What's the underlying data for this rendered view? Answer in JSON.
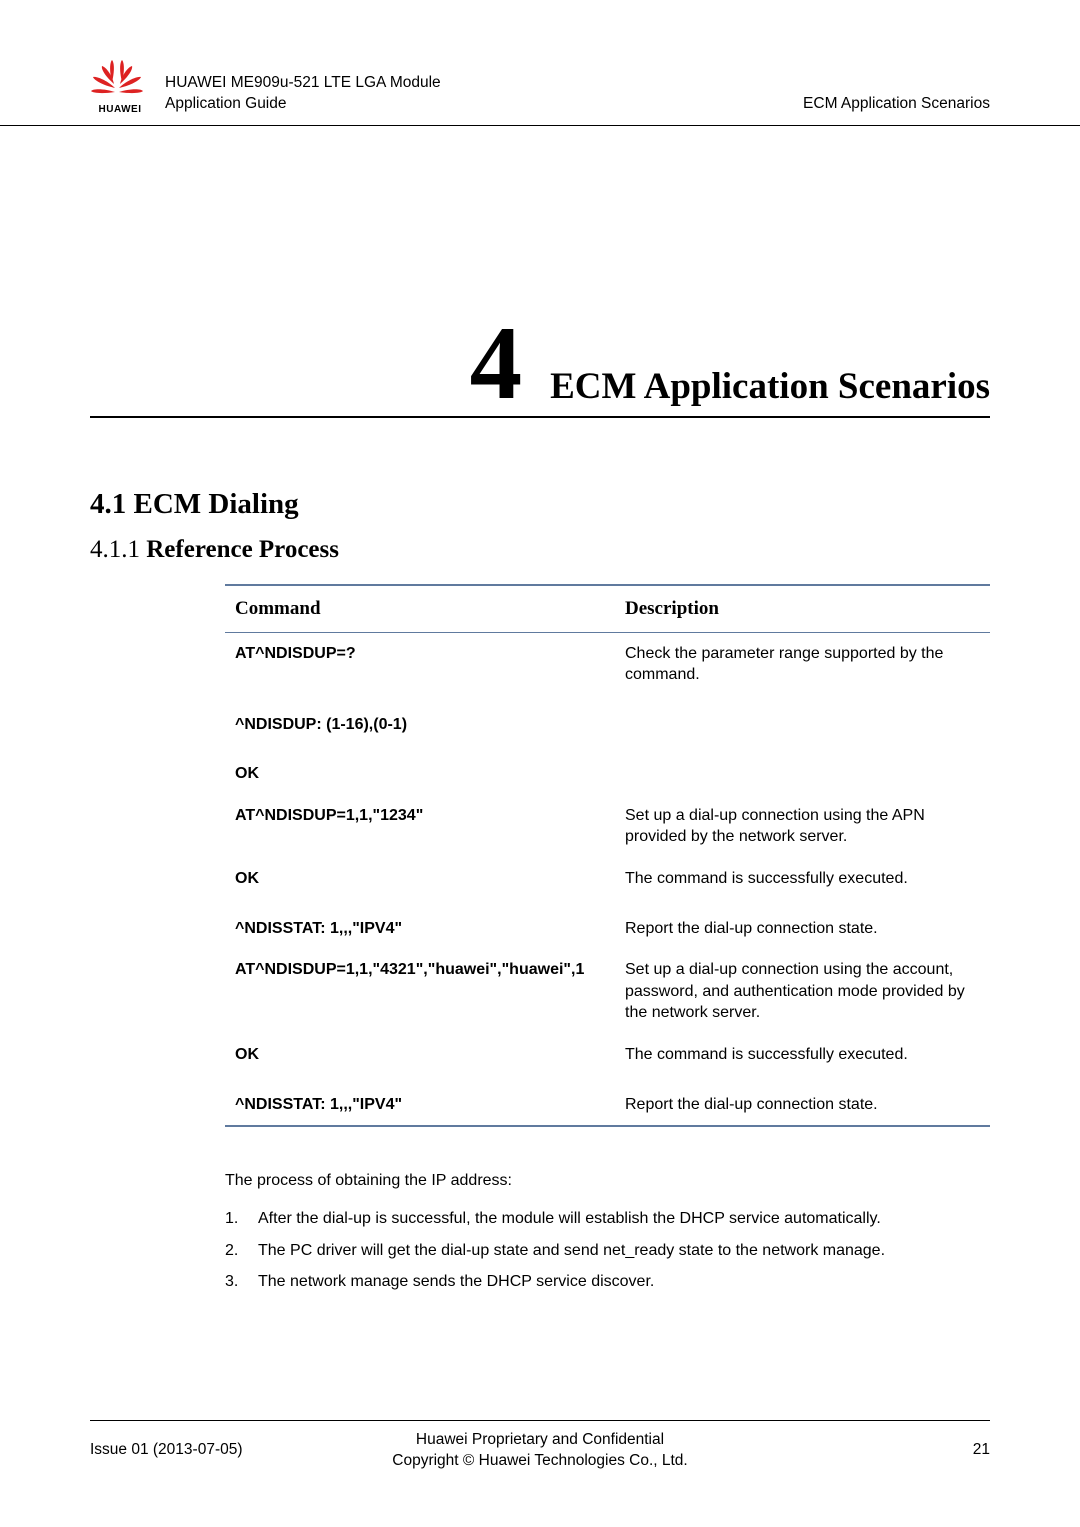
{
  "header": {
    "logo_brand": "HUAWEI",
    "title_line1": "HUAWEI ME909u-521 LTE LGA Module",
    "title_line2": "Application Guide",
    "right": "ECM Application Scenarios"
  },
  "chapter": {
    "number": "4",
    "title": "ECM Application Scenarios"
  },
  "section": {
    "h2": "4.1 ECM Dialing",
    "h3_num": "4.1.1",
    "h3_txt": "Reference Process"
  },
  "table": {
    "head_cmd": "Command",
    "head_desc": "Description",
    "rows": [
      {
        "cmd": "AT^NDISDUP=?",
        "desc": "Check the parameter range supported by the command."
      },
      {
        "cmd": "^NDISDUP: (1-16),(0-1)",
        "desc": ""
      },
      {
        "cmd": "OK",
        "desc": ""
      },
      {
        "cmd": "AT^NDISDUP=1,1,\"1234\"",
        "desc": "Set up a dial-up connection using the APN provided by the network server."
      },
      {
        "cmd": "OK",
        "desc": "The command is successfully executed."
      },
      {
        "cmd": "^NDISSTAT: 1,,,\"IPV4\"",
        "desc": "Report the dial-up connection state."
      },
      {
        "cmd": "AT^NDISDUP=1,1,\"4321\",\"huawei\",\"huawei\",1",
        "desc": "Set up a dial-up connection using the account, password, and authentication mode provided by the network server."
      },
      {
        "cmd": "OK",
        "desc": "The command is successfully executed."
      },
      {
        "cmd": "^NDISSTAT: 1,,,\"IPV4\"",
        "desc": "Report the dial-up connection state."
      }
    ]
  },
  "process": {
    "intro": "The process of obtaining the IP address:",
    "items": [
      "After the dial-up is successful, the module will establish the DHCP service automatically.",
      "The PC driver will get the dial-up state and send net_ready state to the network manage.",
      "The network manage sends the DHCP service discover."
    ]
  },
  "footer": {
    "left": "Issue 01 (2013-07-05)",
    "center_line1": "Huawei Proprietary and Confidential",
    "center_line2": "Copyright © Huawei Technologies Co., Ltd.",
    "right": "21"
  }
}
